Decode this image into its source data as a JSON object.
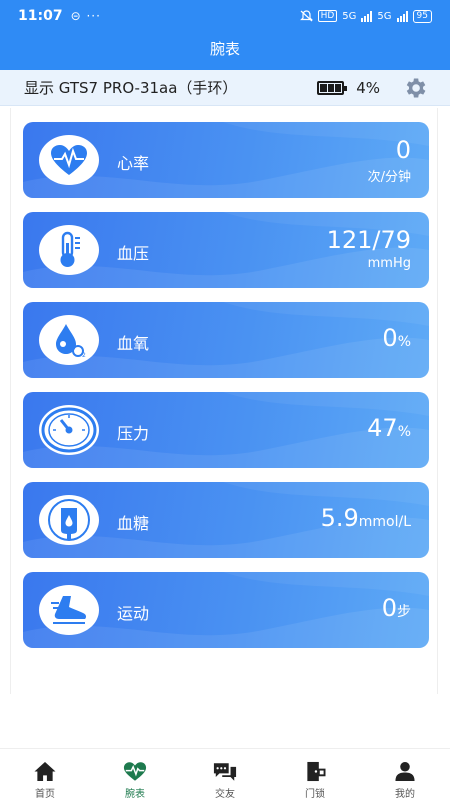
{
  "status_bar": {
    "time": "11:07",
    "left_icons": "⊝ ···",
    "hd": "HD",
    "net1": "5G",
    "net2": "5G",
    "battery": "95"
  },
  "header": {
    "title": "腕表"
  },
  "device": {
    "name": "显示 GTS7 PRO-31aa（手环）",
    "battery_percent": "4%",
    "settings_icon": "gear-icon"
  },
  "metrics": [
    {
      "label": "心率",
      "value": "0",
      "unit": "次/分钟",
      "unit_position": "below",
      "icon": "heart-rate-icon"
    },
    {
      "label": "血压",
      "value": "121/79",
      "unit": "mmHg",
      "unit_position": "below",
      "icon": "thermometer-icon"
    },
    {
      "label": "血氧",
      "value": "0",
      "unit": "%",
      "unit_position": "inline",
      "icon": "oxygen-drop-icon"
    },
    {
      "label": "压力",
      "value": "47",
      "unit": "%",
      "unit_position": "inline",
      "icon": "gauge-icon"
    },
    {
      "label": "血糖",
      "value": "5.9",
      "unit": "mmol/L",
      "unit_position": "inline",
      "icon": "blood-bag-icon"
    },
    {
      "label": "运动",
      "value": "0",
      "unit": "步",
      "unit_position": "inline",
      "icon": "shoe-icon"
    }
  ],
  "colors": {
    "header_bg": "#2f8bf5",
    "card_start": "#3a78ee",
    "card_end": "#5eaaf6",
    "icon_blue": "#2d7df0",
    "nav_active": "#1e7a4e"
  },
  "nav": [
    {
      "label": "首页",
      "icon": "home-icon",
      "active": false
    },
    {
      "label": "腕表",
      "icon": "heart-pulse-icon",
      "active": true
    },
    {
      "label": "交友",
      "icon": "chat-icon",
      "active": false
    },
    {
      "label": "门锁",
      "icon": "door-lock-icon",
      "active": false
    },
    {
      "label": "我的",
      "icon": "person-icon",
      "active": false
    }
  ]
}
